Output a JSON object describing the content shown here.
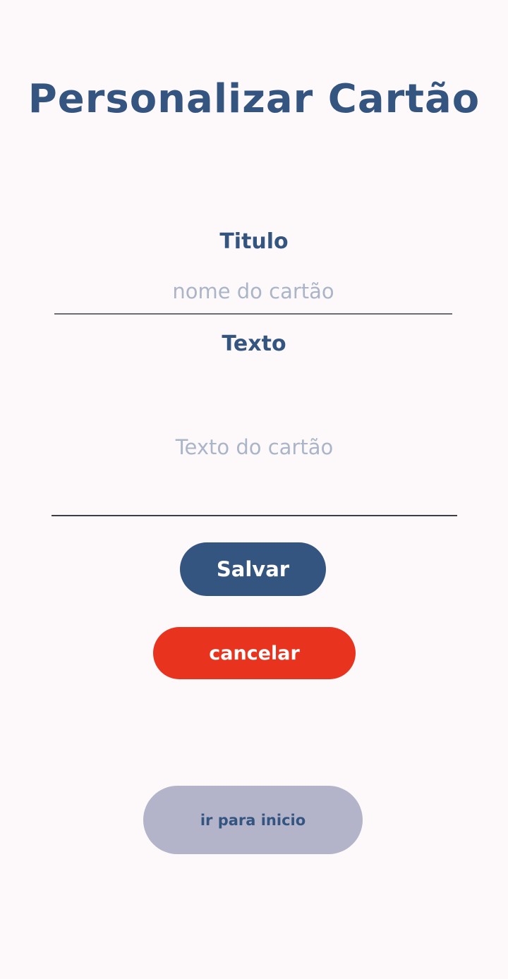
{
  "header": {
    "title": "Personalizar Cartão"
  },
  "form": {
    "titulo": {
      "label": "Titulo",
      "placeholder": "nome do cartão",
      "value": ""
    },
    "texto": {
      "label": "Texto",
      "placeholder": "Texto do cartão",
      "value": ""
    }
  },
  "actions": {
    "save_label": "Salvar",
    "cancel_label": "cancelar",
    "home_label": "ir para inicio"
  },
  "colors": {
    "primary": "#355581",
    "danger": "#e8341f",
    "secondary": "#b3b3c9",
    "background": "#fdf9fb",
    "placeholder": "#aab5c8"
  }
}
